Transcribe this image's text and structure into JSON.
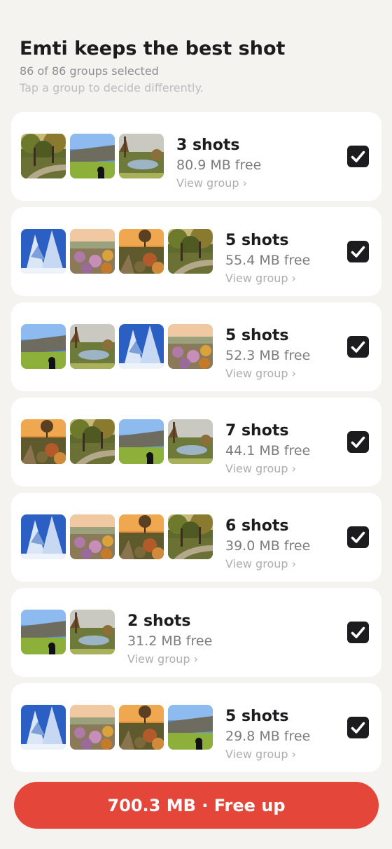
{
  "header": {
    "title": "Emti keeps the best shot",
    "subtitle": "86 of 86 groups selected",
    "hint": "Tap a group to decide differently."
  },
  "groups": [
    {
      "shots": "3 shots",
      "free": "80.9 MB free",
      "view": "View group ›",
      "selected": true,
      "photos": [
        "autumn-path-photo",
        "dam-wall-photo",
        "garden-pond-photo"
      ]
    },
    {
      "shots": "5 shots",
      "free": "55.4 MB free",
      "view": "View group ›",
      "selected": true,
      "photos": [
        "snowy-tree-photo",
        "heather-garden-photo",
        "sunset-garden-photo",
        "autumn-path-photo"
      ]
    },
    {
      "shots": "5 shots",
      "free": "52.3 MB free",
      "view": "View group ›",
      "selected": true,
      "photos": [
        "dam-wall-photo",
        "garden-pond-photo",
        "snowy-tree-photo",
        "heather-garden-photo"
      ]
    },
    {
      "shots": "7 shots",
      "free": "44.1 MB free",
      "view": "View group ›",
      "selected": true,
      "photos": [
        "sunset-garden-photo",
        "autumn-path-photo",
        "dam-wall-photo",
        "garden-pond-photo"
      ]
    },
    {
      "shots": "6 shots",
      "free": "39.0 MB free",
      "view": "View group ›",
      "selected": true,
      "photos": [
        "snowy-tree-photo",
        "heather-garden-photo",
        "sunset-garden-photo",
        "autumn-path-photo"
      ]
    },
    {
      "shots": "2 shots",
      "free": "31.2 MB free",
      "view": "View group ›",
      "selected": true,
      "photos": [
        "dam-wall-photo",
        "garden-pond-photo"
      ]
    },
    {
      "shots": "5 shots",
      "free": "29.8 MB free",
      "view": "View group ›",
      "selected": true,
      "photos": [
        "snowy-tree-photo",
        "heather-garden-photo",
        "sunset-garden-photo",
        "dam-wall-photo"
      ]
    }
  ],
  "cta": {
    "label": "700.3 MB · Free up"
  },
  "colors": {
    "background": "#f4f3ef",
    "card": "#ffffff",
    "accent": "#e5463a",
    "checkbox": "#1c1c1e"
  }
}
